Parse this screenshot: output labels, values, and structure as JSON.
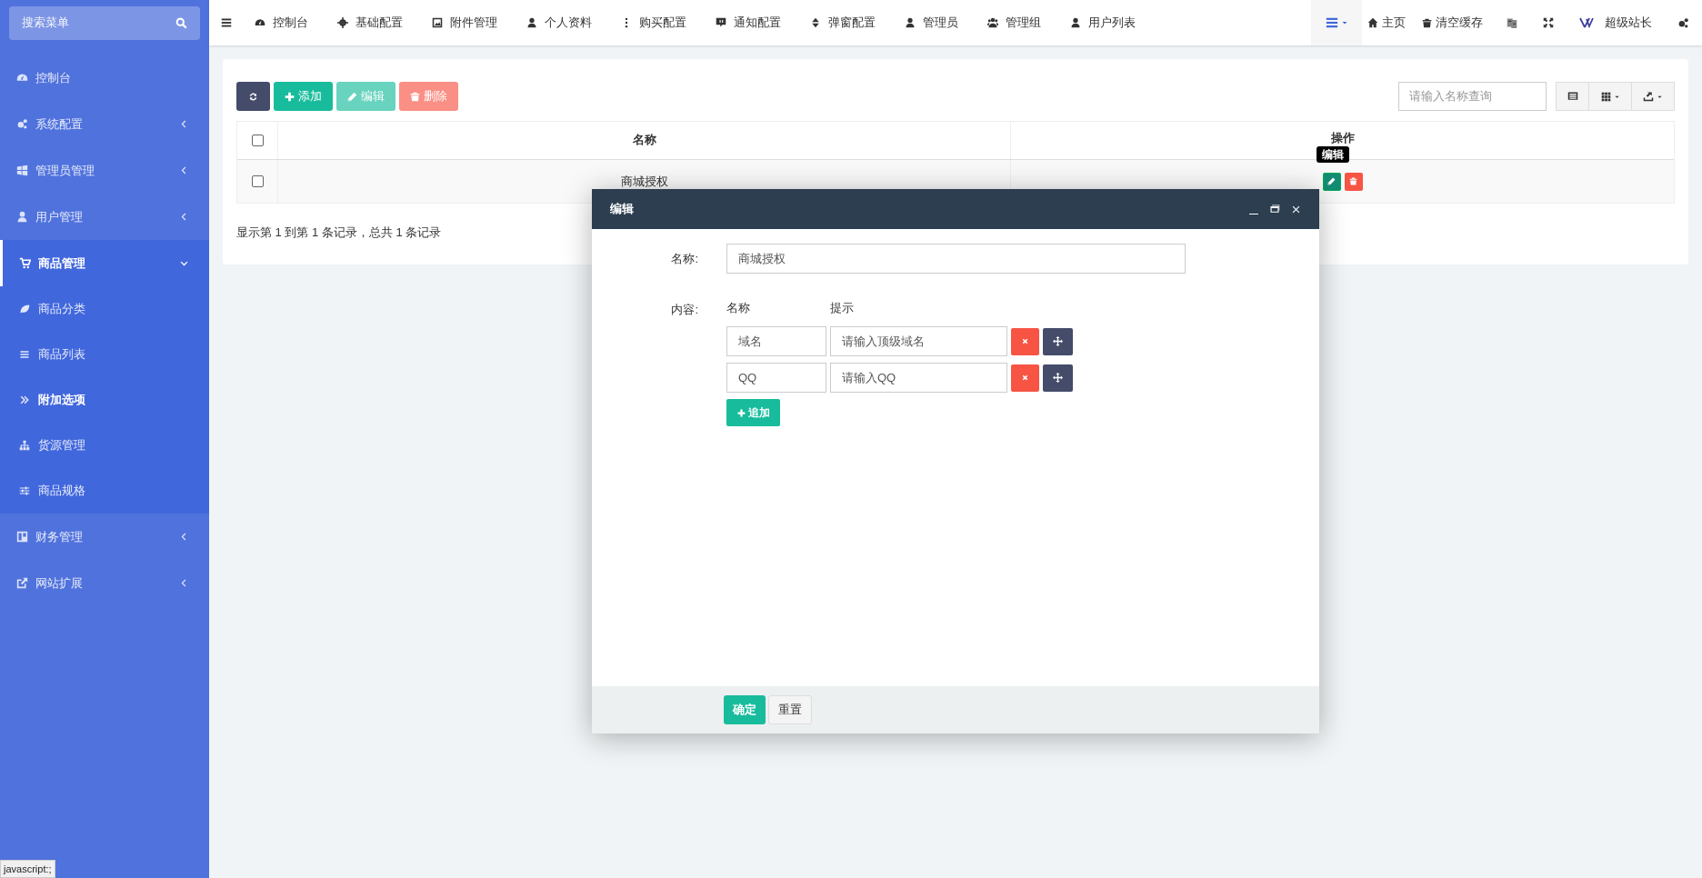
{
  "sidebar": {
    "search_placeholder": "搜索菜单",
    "items": [
      {
        "label": "控制台",
        "selected": false
      },
      {
        "label": "系统配置",
        "selected": false,
        "expanded": false
      },
      {
        "label": "管理员管理",
        "selected": false,
        "expanded": false
      },
      {
        "label": "用户管理",
        "selected": false,
        "expanded": false
      },
      {
        "label": "商品管理",
        "selected": true,
        "expanded": true,
        "children": [
          {
            "label": "商品分类",
            "selected": false
          },
          {
            "label": "商品列表",
            "selected": false
          },
          {
            "label": "附加选项",
            "selected": true
          },
          {
            "label": "货源管理",
            "selected": false
          },
          {
            "label": "商品规格",
            "selected": false
          }
        ]
      },
      {
        "label": "财务管理",
        "selected": false,
        "expanded": false
      },
      {
        "label": "网站扩展",
        "selected": false,
        "expanded": false
      }
    ]
  },
  "top_nav": {
    "tabs": [
      "控制台",
      "基础配置",
      "附件管理",
      "个人资料",
      "购买配置",
      "通知配置",
      "弹窗配置",
      "管理员",
      "管理组",
      "用户列表"
    ],
    "right": {
      "home": "主页",
      "clear_cache": "清空缓存",
      "user": "超级站长"
    }
  },
  "toolbar": {
    "buttons": [
      {
        "kind": "refresh",
        "disabled": false
      },
      {
        "kind": "add",
        "label": "添加",
        "disabled": false
      },
      {
        "kind": "edit",
        "label": "编辑",
        "disabled": true
      },
      {
        "kind": "delete",
        "label": "删除",
        "disabled": true
      }
    ],
    "search_placeholder": "请输入名称查询"
  },
  "table": {
    "select_all_checked": false,
    "columns": [
      "名称",
      "操作"
    ],
    "rows": [
      {
        "name": "商城授权",
        "checked": false
      }
    ],
    "tooltip": "编辑",
    "summary": "显示第 1 到第 1 条记录，总共 1 条记录"
  },
  "dialog": {
    "title": "编辑",
    "name_label": "名称:",
    "name_value": "商城授权",
    "content_label": "内容:",
    "content_columns": [
      "名称",
      "提示"
    ],
    "content_rows": [
      {
        "name": "域名",
        "hint": "请输入顶级域名"
      },
      {
        "name": "QQ",
        "hint": "请输入QQ"
      }
    ],
    "append_button": "追加",
    "buttons": [
      "确定",
      "重置"
    ]
  },
  "status_text": "javascript:;"
}
